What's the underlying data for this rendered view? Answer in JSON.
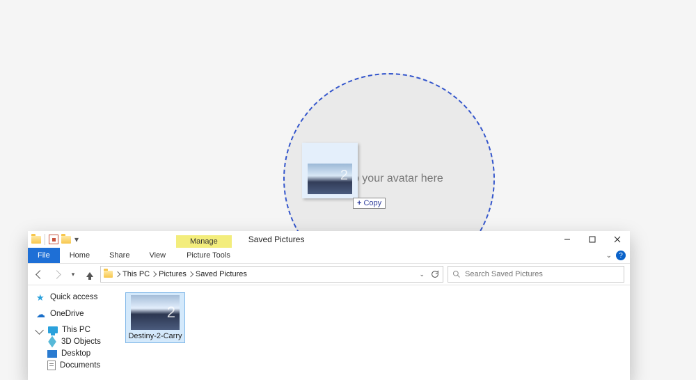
{
  "dropzone": {
    "hint": "Drop your avatar here"
  },
  "drag": {
    "badge_label": "Copy"
  },
  "window": {
    "context_tab": "Manage",
    "context_lower": "Picture Tools",
    "title": "Saved Pictures"
  },
  "ribbon": {
    "file": "File",
    "home": "Home",
    "share": "Share",
    "view": "View"
  },
  "breadcrumbs": [
    "This PC",
    "Pictures",
    "Saved Pictures"
  ],
  "search": {
    "placeholder": "Search Saved Pictures"
  },
  "sidebar": {
    "quick_access": "Quick access",
    "onedrive": "OneDrive",
    "this_pc": "This PC",
    "children": [
      "3D Objects",
      "Desktop",
      "Documents"
    ]
  },
  "files": [
    {
      "name": "Destiny-2-Carry",
      "badge": "2"
    }
  ]
}
